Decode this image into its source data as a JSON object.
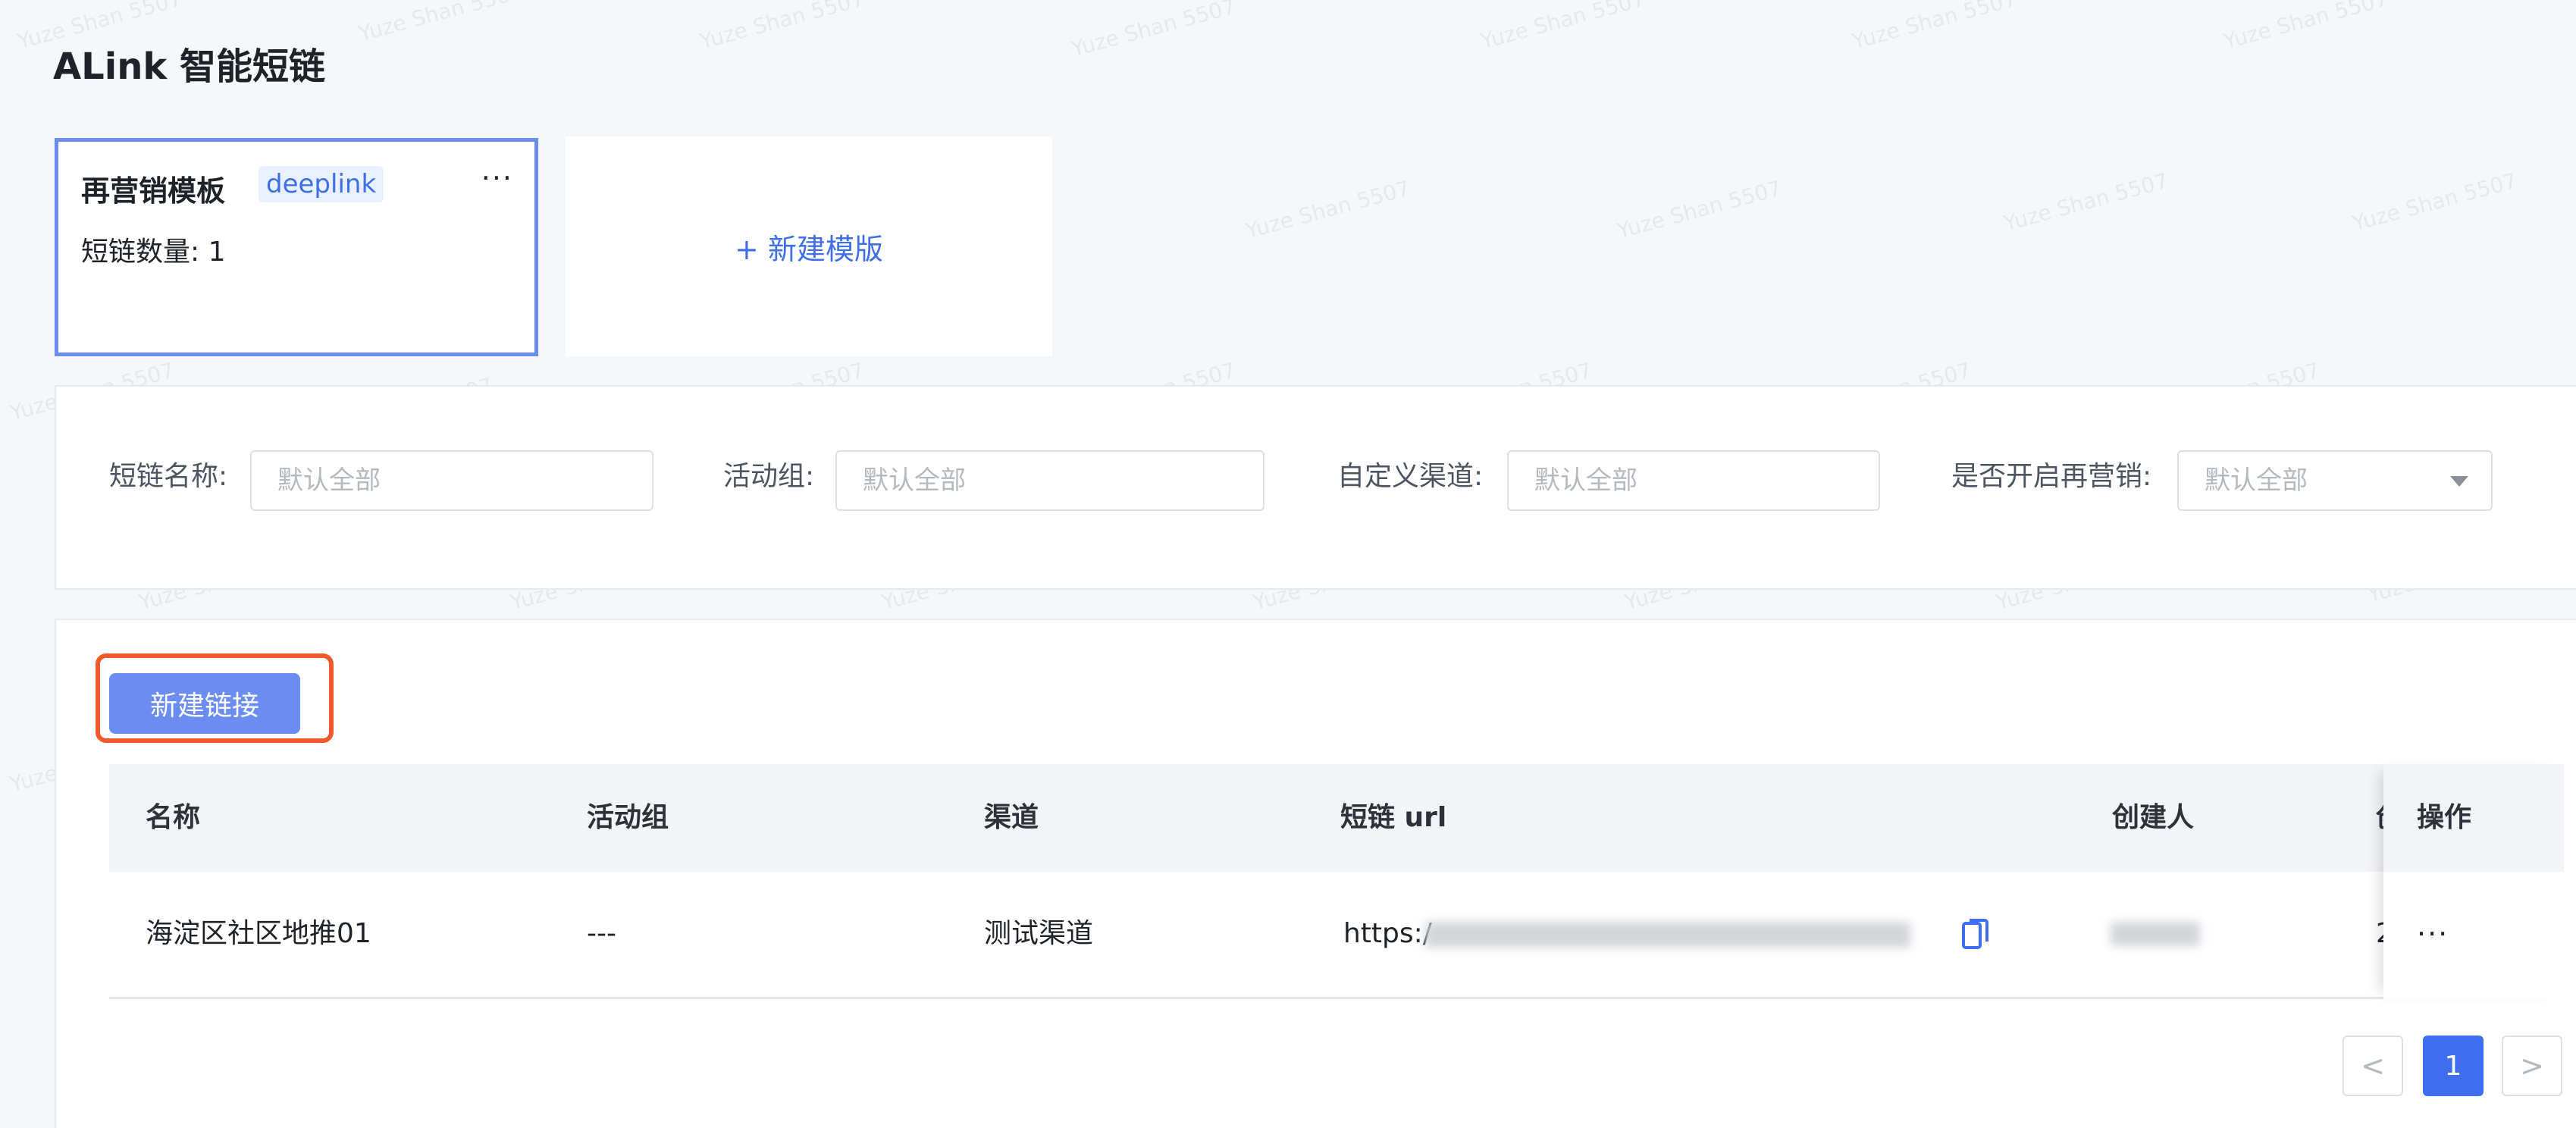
{
  "page": {
    "title": "ALink 智能短链"
  },
  "templates": {
    "card": {
      "name": "再营销模板",
      "tag": "deeplink",
      "more": "···",
      "count_label": "短链数量: 1"
    },
    "new_label": "+ 新建模版"
  },
  "filters": [
    {
      "label": "短链名称:",
      "placeholder": "默认全部"
    },
    {
      "label": "活动组:",
      "placeholder": "默认全部"
    },
    {
      "label": "自定义渠道:",
      "placeholder": "默认全部"
    },
    {
      "label": "是否开启再营销:",
      "placeholder": "默认全部"
    }
  ],
  "toolbar": {
    "new_link_label": "新建链接"
  },
  "table": {
    "columns": [
      "名称",
      "活动组",
      "渠道",
      "短链 url",
      "创建人",
      "创",
      "操作"
    ],
    "rows": [
      {
        "name": "海淀区社区地推01",
        "group": "---",
        "channel": "测试渠道",
        "url_prefix": "https:/",
        "created_prefix": "2",
        "action": "···"
      }
    ]
  },
  "pagination": {
    "prev": "<",
    "current": "1",
    "next": ">"
  },
  "watermark": "Yuze Shan 5507",
  "colors": {
    "primary": "#3f6ff0",
    "button": "#6b8cf0",
    "highlight": "#f05a2a"
  }
}
